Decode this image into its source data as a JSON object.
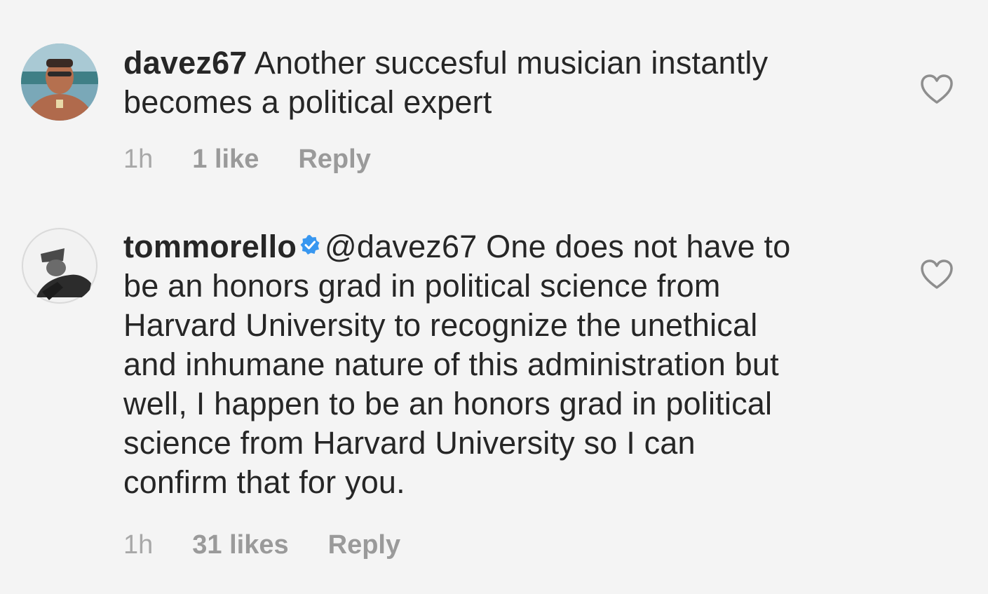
{
  "comments": [
    {
      "username": "davez67",
      "verified": false,
      "mention": "",
      "text_lines": [
        "Another succesful musician instantly",
        "becomes a political expert"
      ],
      "time": "1h",
      "likes": "1 like",
      "reply_label": "Reply",
      "like_icon": "heart-outline-icon"
    },
    {
      "username": "tommorello",
      "verified": true,
      "mention": "@davez67",
      "text_lines": [
        "One does not have to",
        "be an honors grad in political science from",
        "Harvard University to recognize the unethical",
        "and inhumane nature of this administration but",
        "well, I happen to be an honors grad in political",
        "science from Harvard University so I can",
        "confirm that for you."
      ],
      "time": "1h",
      "likes": "31 likes",
      "reply_label": "Reply",
      "like_icon": "heart-outline-icon"
    }
  ],
  "colors": {
    "background": "#f4f4f4",
    "text": "#262626",
    "meta": "#9a9a9a",
    "verified": "#3897f0"
  }
}
